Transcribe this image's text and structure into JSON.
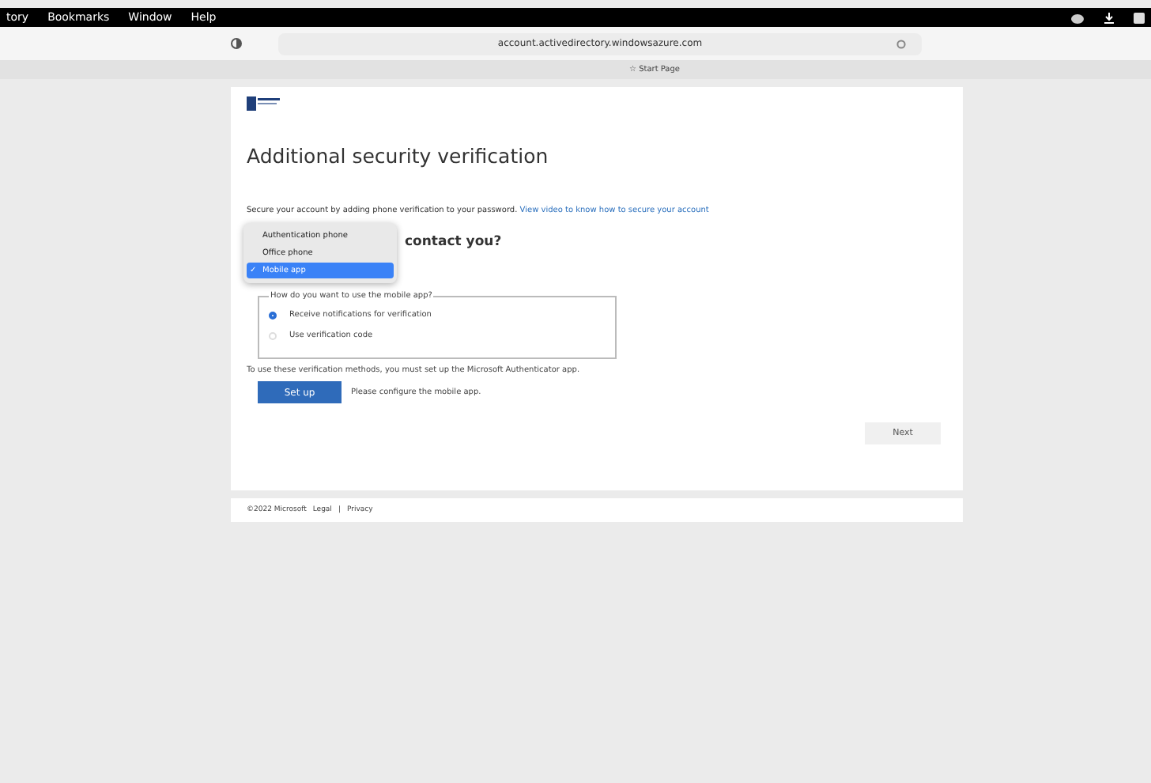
{
  "menu_bar": {
    "items": [
      "tory",
      "Bookmarks",
      "Window",
      "Help"
    ]
  },
  "toolbar": {
    "address": "account.activedirectory.windowsazure.com"
  },
  "bookmarks_bar": {
    "star": "☆",
    "items": [
      "Start Page"
    ]
  },
  "page": {
    "title": "Additional security verification",
    "intro": "Secure your account by adding phone verification to your password.",
    "intro_link": "View video to know how to secure your account",
    "heading": "contact you?",
    "method_menu": [
      {
        "label": "Authentication phone",
        "selected": false
      },
      {
        "label": "Office phone",
        "selected": false
      },
      {
        "label": "Mobile app",
        "selected": true
      }
    ],
    "method_menu_checkmark": "✓",
    "usage": {
      "legend": "How do you want to use the mobile app?",
      "options": [
        {
          "label": "Receive notifications for verification",
          "selected": true
        },
        {
          "label": "Use verification code",
          "selected": false
        }
      ]
    },
    "setup_note": "To use these verification methods, you must set up the Microsoft Authenticator app.",
    "setup_button": "Set up",
    "setup_hint": "Please configure the mobile app.",
    "next_button": "Next"
  },
  "footer": {
    "copyright": "©2022 Microsoft",
    "links": [
      "Legal",
      "Privacy"
    ],
    "separator": "|"
  }
}
